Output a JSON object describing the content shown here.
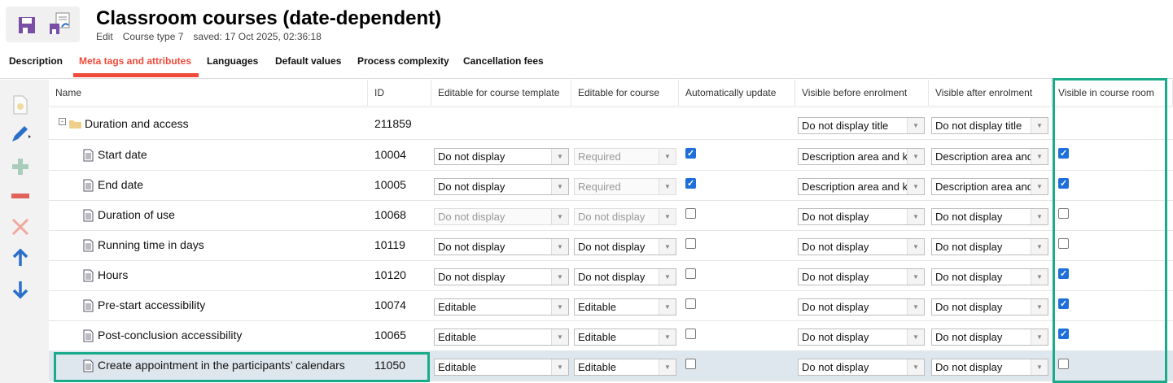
{
  "header": {
    "title": "Classroom courses (date-dependent)",
    "mode": "Edit",
    "course_type": "Course type 7",
    "saved": "saved: 17 Oct 2025, 02:36:18"
  },
  "tabs": [
    {
      "label": "Description"
    },
    {
      "label": "Meta tags and attributes",
      "active": true
    },
    {
      "label": "Languages"
    },
    {
      "label": "Default values"
    },
    {
      "label": "Process complexity"
    },
    {
      "label": "Cancellation fees"
    }
  ],
  "toolbar": [
    "new-attribute-icon",
    "edit-icon",
    "add-icon",
    "remove-icon",
    "delete-icon",
    "move-up-icon",
    "move-down-icon"
  ],
  "columns": [
    "Name",
    "ID",
    "Editable for course template",
    "Editable for course",
    "Automatically update",
    "Visible before enrolment",
    "Visible after enrolment",
    "Visible in course room"
  ],
  "group": {
    "name": "Duration and access",
    "id": "211859",
    "before": "Do not display title",
    "after": "Do not display title"
  },
  "rows": [
    {
      "name": "Start date",
      "id": "10004",
      "tmpl": "Do not display",
      "tmpl_dis": false,
      "course": "Required",
      "course_dis": true,
      "auto": true,
      "before": "Description area and ke",
      "after": "Description area and",
      "room": true
    },
    {
      "name": "End date",
      "id": "10005",
      "tmpl": "Do not display",
      "tmpl_dis": false,
      "course": "Required",
      "course_dis": true,
      "auto": true,
      "before": "Description area and ke",
      "after": "Description area and",
      "room": true
    },
    {
      "name": "Duration of use",
      "id": "10068",
      "tmpl": "Do not display",
      "tmpl_dis": true,
      "course": "Do not display",
      "course_dis": true,
      "auto": false,
      "before": "Do not display",
      "after": "Do not display",
      "room": false
    },
    {
      "name": "Running time in days",
      "id": "10119",
      "tmpl": "Do not display",
      "tmpl_dis": false,
      "course": "Do not display",
      "course_dis": false,
      "auto": false,
      "before": "Do not display",
      "after": "Do not display",
      "room": false
    },
    {
      "name": "Hours",
      "id": "10120",
      "tmpl": "Do not display",
      "tmpl_dis": false,
      "course": "Do not display",
      "course_dis": false,
      "auto": false,
      "before": "Do not display",
      "after": "Do not display",
      "room": true
    },
    {
      "name": "Pre-start accessibility",
      "id": "10074",
      "tmpl": "Editable",
      "tmpl_dis": false,
      "course": "Editable",
      "course_dis": false,
      "auto": false,
      "before": "Do not display",
      "after": "Do not display",
      "room": true
    },
    {
      "name": "Post-conclusion accessibility",
      "id": "10065",
      "tmpl": "Editable",
      "tmpl_dis": false,
      "course": "Editable",
      "course_dis": false,
      "auto": false,
      "before": "Do not display",
      "after": "Do not display",
      "room": true
    },
    {
      "name": "Create appointment in the participants’ calendars",
      "id": "11050",
      "tmpl": "Editable",
      "tmpl_dis": false,
      "course": "Editable",
      "course_dis": false,
      "auto": false,
      "before": "Do not display",
      "after": "Do not display",
      "room": false,
      "selected": true
    }
  ],
  "colors": {
    "accent": "#f04a3a",
    "highlight": "#1aab8b",
    "checkbox": "#1e6fd9"
  }
}
